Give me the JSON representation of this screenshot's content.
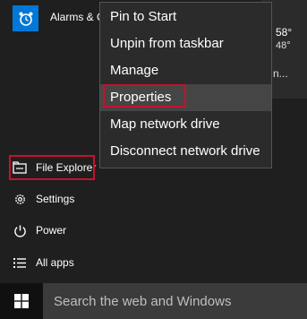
{
  "app_tile": {
    "label": "Alarms & C",
    "icon": "alarm-clock-icon"
  },
  "weather": {
    "temp": "58°",
    "temp2": "48°",
    "location": "n...",
    "sun": "e"
  },
  "context_menu": {
    "items": [
      {
        "label": "Pin to Start"
      },
      {
        "label": "Unpin from taskbar"
      },
      {
        "label": "Manage"
      },
      {
        "label": "Properties"
      },
      {
        "label": "Map network drive"
      },
      {
        "label": "Disconnect network drive"
      }
    ],
    "highlighted": "Properties"
  },
  "left_list": {
    "items": [
      {
        "label": "File Explorer",
        "icon": "folder-icon"
      },
      {
        "label": "Settings",
        "icon": "gear-icon"
      },
      {
        "label": "Power",
        "icon": "power-icon"
      },
      {
        "label": "All apps",
        "icon": "list-icon"
      }
    ]
  },
  "taskbar": {
    "search_placeholder": "Search the web and Windows",
    "start_icon": "windows-logo-icon"
  },
  "colors": {
    "highlight_box": "#c8102e",
    "tile_blue": "#0078d7",
    "menu_bg": "#2b2b2b",
    "hover_bg": "#454545"
  }
}
